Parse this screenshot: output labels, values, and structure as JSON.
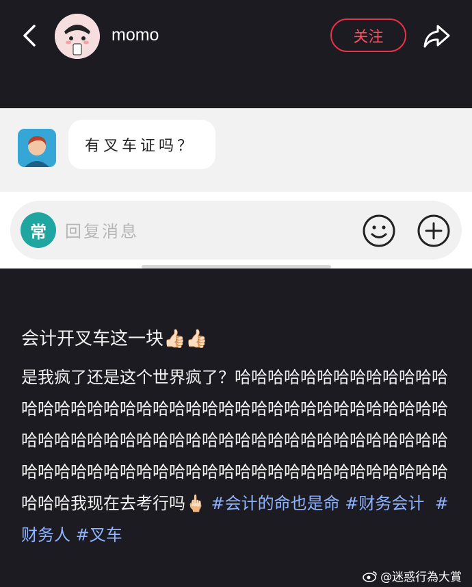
{
  "header": {
    "username": "momo",
    "follow_label": "关注",
    "back_icon": "chevron-left-icon",
    "share_icon": "share-arrow-icon"
  },
  "chat": {
    "message": "有叉车证吗？"
  },
  "reply_bar": {
    "badge": "常",
    "placeholder": "回复消息",
    "emoji_icon": "smiley-icon",
    "add_icon": "plus-circle-icon"
  },
  "post": {
    "title": "会计开叉车这一块👍🏻👍🏻",
    "body": "是我疯了还是这个世界疯了？哈哈哈哈哈哈哈哈哈哈哈哈哈哈哈哈哈哈哈哈哈哈哈哈哈哈哈哈哈哈哈哈哈哈哈哈哈哈哈哈哈哈哈哈哈哈哈哈哈哈哈哈哈哈哈哈哈哈哈哈哈哈哈哈哈哈哈哈哈哈哈哈哈哈哈哈哈哈哈哈哈哈哈哈哈哈哈哈哈哈哈哈哈哈我现在去考行吗🖕🏻",
    "tags": [
      "#会计的命也是命",
      "#财务会计",
      "#财务人",
      "#叉车"
    ]
  },
  "watermark": "@迷惑行為大賞",
  "colors": {
    "background": "#1c1b22",
    "accent_red": "#e8344a",
    "tag_blue": "#8fb4ff",
    "badge_teal": "#1fa6a0"
  }
}
